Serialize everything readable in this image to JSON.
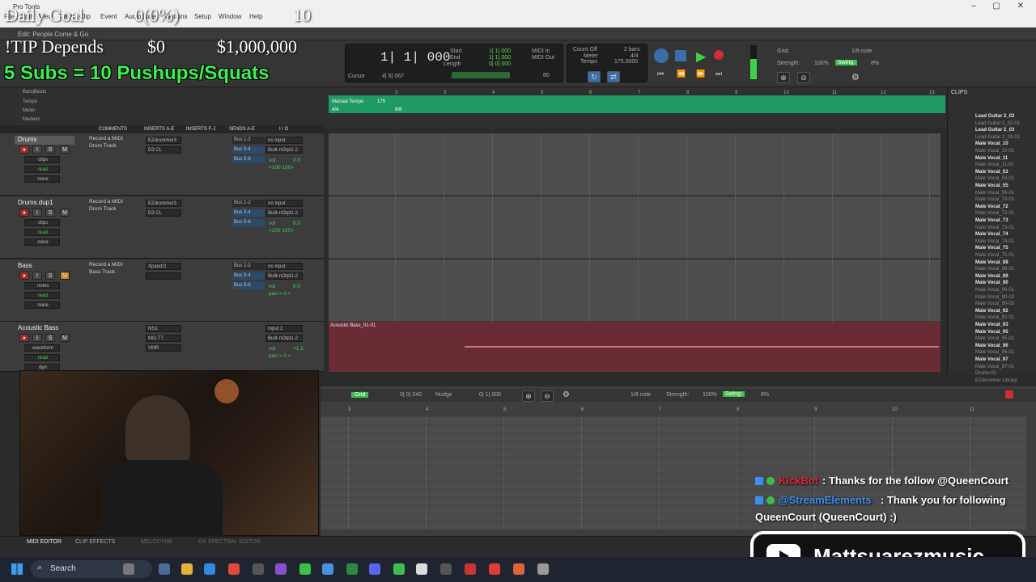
{
  "window": {
    "title": "Pro Tools",
    "menus": [
      "File",
      "Edit",
      "View",
      "Track",
      "Clip",
      "Event",
      "AudioSuite",
      "Options",
      "Setup",
      "Window",
      "Help"
    ],
    "edit_title": "Edit: People Come & Go"
  },
  "overlay": {
    "daily_goal_label": "Daily Goal",
    "daily_goal_value": "0(0%)",
    "daily_goal_right": "10",
    "tip_label": "!TIP Depends",
    "tip_value": "$0",
    "tip_goal": "$1,000,000",
    "subs_text": "5 Subs = 10 Pushups/Squats"
  },
  "transport": {
    "main_counter": "1| 1| 000",
    "cursor_label": "Cursor",
    "cursor_value": "4| 5| 067",
    "start_label": "Start",
    "end_label": "End",
    "length_label": "Length",
    "start_value": "1| 1| 000",
    "end_value": "1| 1| 000",
    "length_value": "0| 0| 000",
    "midi_in": "MIDI In",
    "midi_out": "MIDI Out",
    "count_off": "Count Off",
    "meter_label": "Meter",
    "tempo_label": "Tempo",
    "bars": "2 bars",
    "meter_value": "4/4",
    "tempo_value": "175.0000",
    "velocity": "80",
    "grid_label": "Grid:",
    "grid_value": "1/8 note",
    "strength_label": "Strength:",
    "strength_value": "100%",
    "swing_label": "Swing:",
    "swing_value": "8%"
  },
  "rulers": {
    "bars_beats": "Bars|Beats",
    "tempo": "Tempo",
    "meter": "Meter",
    "markers": "Markers",
    "manual_tempo": "Manual Tempo",
    "tempo_mark": "175",
    "meter_mark": "4/4",
    "meter_mark2": "6/8",
    "bar_numbers": [
      "2",
      "3",
      "4",
      "5",
      "6",
      "7",
      "8",
      "9",
      "10",
      "11",
      "12",
      "13"
    ]
  },
  "mix_headers": [
    "COMMENTS",
    "INSERTS A-E",
    "INSERTS F-J",
    "SENDS A-E",
    "I / O"
  ],
  "tracks": [
    {
      "name": "Drums",
      "comment1": "Record a MIDI",
      "comment2": "Drum Track",
      "insert1": "EZdrummer3",
      "insert2": "D3 CL",
      "send1": "Bus 1-2",
      "send2": "Bus 3-4",
      "send3": "Bus 5-6",
      "input": "no input",
      "output": "Built-nOtpt1-2",
      "vol_label": "vol",
      "vol": "0.0",
      "pan": "<100  100>",
      "view": "clips",
      "auto": "read",
      "group": "none"
    },
    {
      "name": "Drums.dup1",
      "comment1": "Record a MIDI",
      "comment2": "Drum Track",
      "insert1": "EZdrummer3",
      "insert2": "D3 CL",
      "send1": "Bus 1-2",
      "send2": "Bus 3-4",
      "send3": "Bus 5-6",
      "input": "no input",
      "output": "Built-nOtpt1-2",
      "vol_label": "vol",
      "vol": "0.0",
      "pan": "<100  100>",
      "view": "clips",
      "auto": "read",
      "group": "none"
    },
    {
      "name": "Bass",
      "comment1": "Record a MIDI",
      "comment2": "Bass Track",
      "insert1": "Xpand!2",
      "insert2": "",
      "send1": "Bus 1-2",
      "send2": "Bus 3-4",
      "send3": "Bus 5-6",
      "input": "no input",
      "output": "Built-nOtpt1-2",
      "vol_label": "vol",
      "vol": "0.0",
      "pan": "pan  > 0 <",
      "view": "notes",
      "auto": "read",
      "group": "none"
    },
    {
      "name": "Acoustic Bass",
      "comment1": "",
      "comment2": "",
      "insert1": "NS1",
      "insert2": "MO-TT",
      "send1": "",
      "send2": "",
      "send3": "",
      "input": "Input 2",
      "output": "Built-nOtpt1-2",
      "vol_label": "vol",
      "vol": "+1.2",
      "pan": "pan  > 0 <",
      "view": "waveform",
      "auto": "read",
      "group": "dyn",
      "insert3": "VMR"
    }
  ],
  "clip_audio_label": "Acoustic Bass_01-01",
  "clips_panel": {
    "title": "CLIPS",
    "items": [
      {
        "name": "Lead Guitar 2_02",
        "bold": true
      },
      {
        "name": "Lead Guitar 2_02-01",
        "bold": false
      },
      {
        "name": "Lead Guitar 2_03",
        "bold": true
      },
      {
        "name": "Lead Guitar 2_03-01",
        "bold": false
      },
      {
        "name": "Male Vocal_10",
        "bold": true
      },
      {
        "name": "Male Vocal_10-01",
        "bold": false
      },
      {
        "name": "Male Vocal_11",
        "bold": true
      },
      {
        "name": "Male Vocal_11-01",
        "bold": false
      },
      {
        "name": "Male Vocal_53",
        "bold": true
      },
      {
        "name": "Male Vocal_53-01",
        "bold": false
      },
      {
        "name": "Male Vocal_55",
        "bold": true
      },
      {
        "name": "Male Vocal_55-01",
        "bold": false
      },
      {
        "name": "Male Vocal_70-03",
        "bold": false
      },
      {
        "name": "Male Vocal_72",
        "bold": true
      },
      {
        "name": "Male Vocal_72-01",
        "bold": false
      },
      {
        "name": "Male Vocal_73",
        "bold": true
      },
      {
        "name": "Male Vocal_73-01",
        "bold": false
      },
      {
        "name": "Male Vocal_74",
        "bold": true
      },
      {
        "name": "Male Vocal_74-01",
        "bold": false
      },
      {
        "name": "Male Vocal_75",
        "bold": true
      },
      {
        "name": "Male Vocal_75-01",
        "bold": false
      },
      {
        "name": "Male Vocal_88",
        "bold": true
      },
      {
        "name": "Male Vocal_88-01",
        "bold": false
      },
      {
        "name": "Male Vocal_89",
        "bold": true
      },
      {
        "name": "Male Vocal_90",
        "bold": true
      },
      {
        "name": "Male Vocal_90-01",
        "bold": false
      },
      {
        "name": "Male Vocal_90-02",
        "bold": false
      },
      {
        "name": "Male Vocal_90-03",
        "bold": false
      },
      {
        "name": "Male Vocal_92",
        "bold": true
      },
      {
        "name": "Male Vocal_92-01",
        "bold": false
      },
      {
        "name": "Male Vocal_93",
        "bold": true
      },
      {
        "name": "Male Vocal_95",
        "bold": true
      },
      {
        "name": "Male Vocal_95-01",
        "bold": false
      },
      {
        "name": "Male Vocal_96",
        "bold": true
      },
      {
        "name": "Male Vocal_96-01",
        "bold": false
      },
      {
        "name": "Male Vocal_97",
        "bold": true
      },
      {
        "name": "Male Vocal_97-01",
        "bold": false
      },
      {
        "name": "Drums-01",
        "bold": false
      },
      {
        "name": "EZdrummer Library",
        "bold": false
      }
    ]
  },
  "midi_editor": {
    "grid_label": "Grid",
    "grid_value": "0| 0| 240",
    "nudge_label": "Nudge",
    "nudge_value": "0| 1| 000",
    "note_value": "1/8 note",
    "strength_label": "Strength:",
    "strength_value": "100%",
    "swing_label": "Swing:",
    "swing_value": "8%",
    "bar_numbers": [
      "3",
      "4",
      "5",
      "6",
      "7",
      "8",
      "9",
      "10",
      "11"
    ]
  },
  "bottom_tabs": [
    "MIDI EDITOR",
    "CLIP EFFECTS",
    "MELODYNE",
    "RX SPECTRAL EDITOR"
  ],
  "chat": [
    {
      "user": "KickBot",
      "message": ": Thanks for the follow @QueenCourt",
      "user_color": "#e0243a"
    },
    {
      "user": "@StreamElements",
      "message": ": Thank you for following",
      "message2": "QueenCourt (QueenCourt) :)",
      "user_color": "#3b8ef0"
    }
  ],
  "youtube_channel": "Mattsuarezmusic",
  "taskbar": {
    "search": "Search"
  },
  "colors": {
    "accent_green": "#3cf050",
    "tempo_strip": "#1e9a62",
    "audio_clip": "#6a2c34"
  }
}
